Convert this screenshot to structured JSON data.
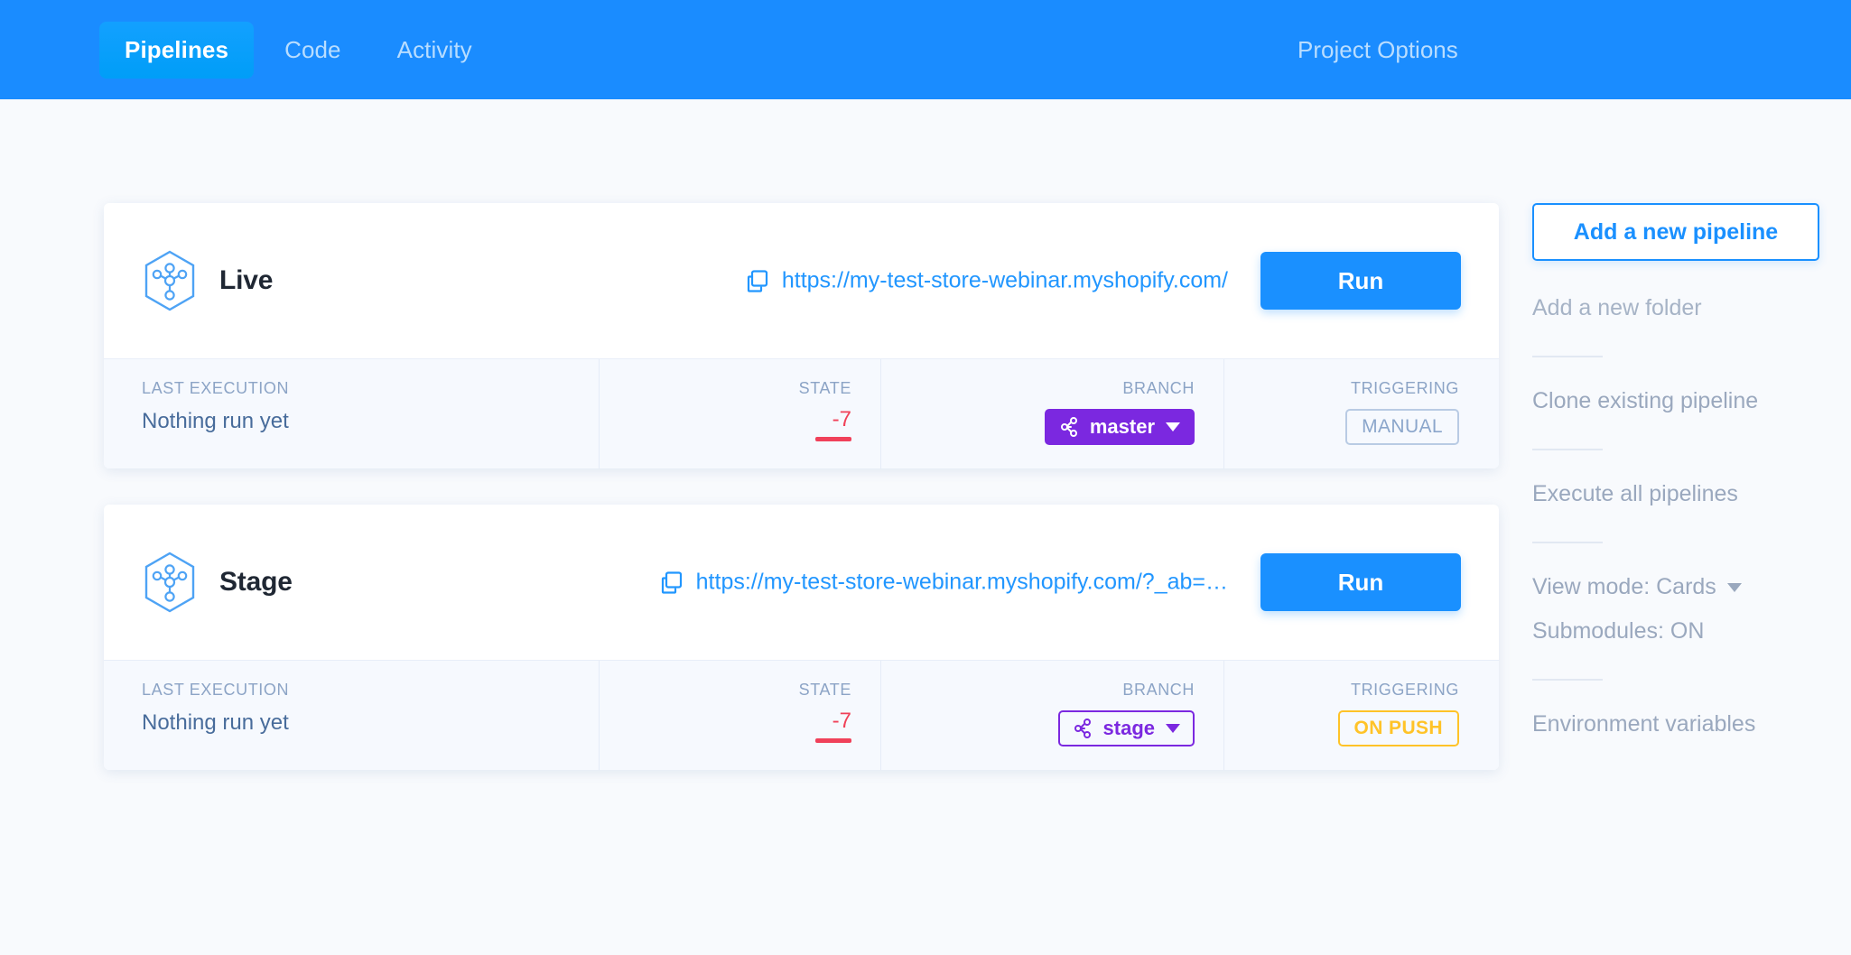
{
  "header": {
    "tabs": [
      {
        "label": "Pipelines",
        "active": true
      },
      {
        "label": "Code",
        "active": false
      },
      {
        "label": "Activity",
        "active": false
      }
    ],
    "project_options_label": "Project Options",
    "background_color": "#1a8cff"
  },
  "stat_labels": {
    "last_execution": "LAST EXECUTION",
    "state": "STATE",
    "branch": "BRANCH",
    "triggering": "TRIGGERING"
  },
  "pipelines": [
    {
      "name": "Live",
      "url": "https://my-test-store-webinar.myshopify.com/",
      "run_label": "Run",
      "last_execution": "Nothing run yet",
      "state": "-7",
      "state_color": "#f04158",
      "branch": "master",
      "branch_style": "filled",
      "branch_color": "#7b28e0",
      "triggering": "MANUAL",
      "triggering_style": "manual",
      "triggering_color": "#8ba6cb"
    },
    {
      "name": "Stage",
      "url": "https://my-test-store-webinar.myshopify.com/?_ab=…",
      "run_label": "Run",
      "last_execution": "Nothing run yet",
      "state": "-7",
      "state_color": "#f04158",
      "branch": "stage",
      "branch_style": "outline",
      "branch_color": "#7b28e0",
      "triggering": "ON PUSH",
      "triggering_style": "onpush",
      "triggering_color": "#ffc328"
    }
  ],
  "sidebar": {
    "add_pipeline": "Add a new pipeline",
    "add_folder": "Add a new folder",
    "clone_pipeline": "Clone existing pipeline",
    "execute_all": "Execute all pipelines",
    "view_mode": "View mode: Cards",
    "submodules": "Submodules: ON",
    "environment_variables": "Environment variables"
  },
  "colors": {
    "accent": "#1a90ff",
    "page_background": "#f8fafd",
    "card_background": "#ffffff",
    "stats_background": "#f6f9fe"
  }
}
